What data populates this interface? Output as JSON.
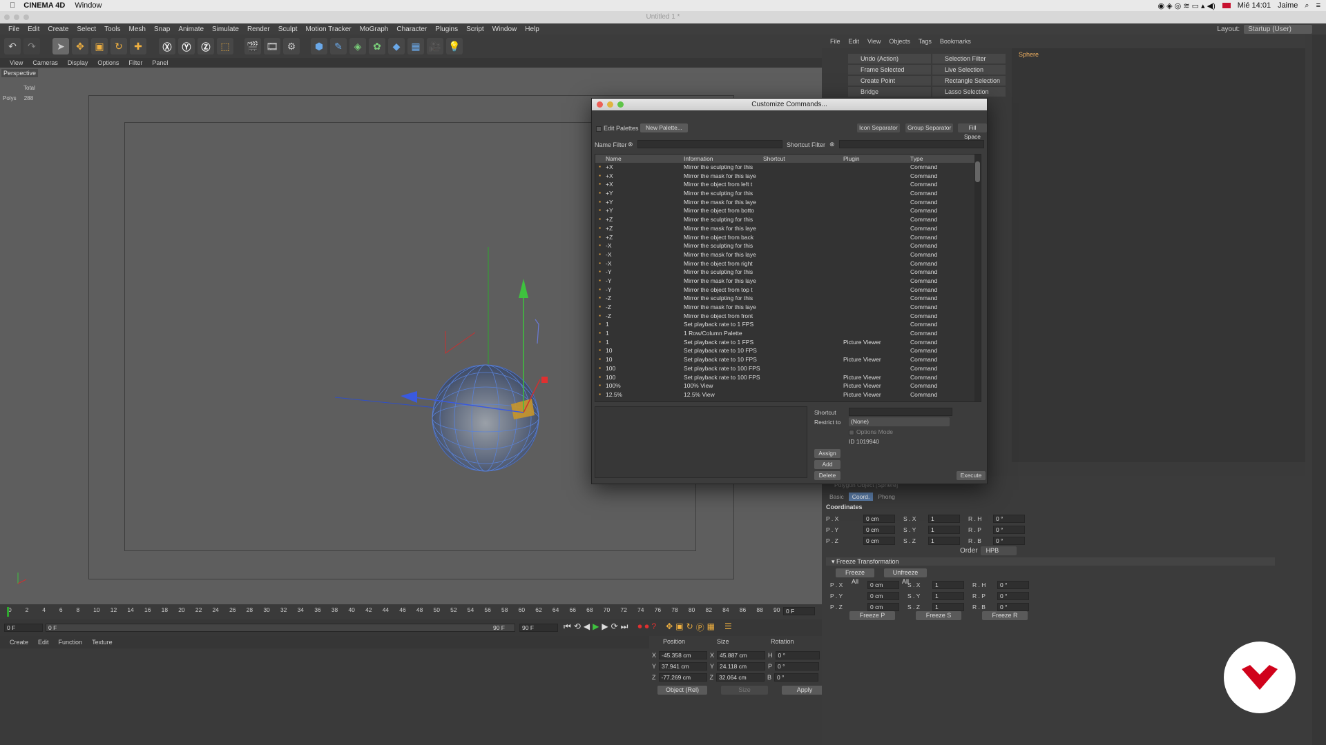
{
  "mac": {
    "app_name": "CINEMA 4D",
    "menu_window": "Window",
    "time": "Mié 14:01",
    "user": "Jaime"
  },
  "window_title": "Untitled 1 *",
  "menus": [
    "File",
    "Edit",
    "Create",
    "Select",
    "Tools",
    "Mesh",
    "Snap",
    "Animate",
    "Simulate",
    "Render",
    "Sculpt",
    "Motion Tracker",
    "MoGraph",
    "Character",
    "Plugins",
    "Script",
    "Window",
    "Help"
  ],
  "layout": {
    "label": "Layout:",
    "value": "Startup (User)"
  },
  "viewport": {
    "menus": [
      "View",
      "Cameras",
      "Display",
      "Options",
      "Filter",
      "Panel"
    ],
    "name": "Perspective",
    "hud_total": "Total",
    "hud_polys_label": "Polys",
    "hud_polys_value": "288"
  },
  "timeline": {
    "ticks": [
      "0",
      "2",
      "4",
      "6",
      "8",
      "10",
      "12",
      "14",
      "16",
      "18",
      "20",
      "22",
      "24",
      "26",
      "28",
      "30",
      "32",
      "34",
      "36",
      "38",
      "40",
      "42",
      "44",
      "46",
      "48",
      "50",
      "52",
      "54",
      "56",
      "58",
      "60",
      "62",
      "64",
      "66",
      "68",
      "70",
      "72",
      "74",
      "76",
      "78",
      "80",
      "82",
      "84",
      "86",
      "88",
      "90"
    ],
    "end_label": "0 F",
    "current": "0 F",
    "range_start": "0 F",
    "range_end": "90 F",
    "max": "90 F"
  },
  "material_manager": {
    "menus": [
      "Create",
      "Edit",
      "Function",
      "Texture"
    ]
  },
  "coord_manager": {
    "headers": [
      "Position",
      "Size",
      "Rotation"
    ],
    "rows": [
      {
        "axis": "X",
        "pos": "-45.358 cm",
        "saxis": "X",
        "size": "45.887 cm",
        "raxis": "H",
        "rot": "0 °"
      },
      {
        "axis": "Y",
        "pos": "37.941 cm",
        "saxis": "Y",
        "size": "24.118 cm",
        "raxis": "P",
        "rot": "0 °"
      },
      {
        "axis": "Z",
        "pos": "-77.269 cm",
        "saxis": "Z",
        "size": "32.064 cm",
        "raxis": "B",
        "rot": "0 °"
      }
    ],
    "mode": "Object (Rel)",
    "size_mode": "Size",
    "apply": "Apply"
  },
  "object_manager": {
    "menus": [
      "File",
      "Edit",
      "View",
      "Objects",
      "Tags",
      "Bookmarks"
    ],
    "object": "Sphere"
  },
  "palette": {
    "left": [
      "Undo (Action)",
      "Frame Selected Elements",
      "Create Point",
      "Bridge"
    ],
    "right": [
      "Selection Filter",
      "Live Selection",
      "Rectangle Selection",
      "Lasso Selection"
    ]
  },
  "attributes": {
    "object_label": "Polygon Object [Sphere]",
    "tabs": [
      "Basic",
      "Coord.",
      "Phong"
    ],
    "section": "Coordinates",
    "coords": [
      {
        "p": "P . X",
        "pv": "0 cm",
        "s": "S . X",
        "sv": "1",
        "r": "R . H",
        "rv": "0 °"
      },
      {
        "p": "P . Y",
        "pv": "0 cm",
        "s": "S . Y",
        "sv": "1",
        "r": "R . P",
        "rv": "0 °"
      },
      {
        "p": "P . Z",
        "pv": "0 cm",
        "s": "S . Z",
        "sv": "1",
        "r": "R . B",
        "rv": "0 °"
      }
    ],
    "order_label": "Order",
    "order_value": "HPB",
    "freeze_section": "Freeze Transformation",
    "freeze_all": "Freeze All",
    "unfreeze_all": "Unfreeze All",
    "freeze_coords": [
      {
        "p": "P . X",
        "pv": "0 cm",
        "s": "S . X",
        "sv": "1",
        "r": "R . H",
        "rv": "0 °"
      },
      {
        "p": "P . Y",
        "pv": "0 cm",
        "s": "S . Y",
        "sv": "1",
        "r": "R . P",
        "rv": "0 °"
      },
      {
        "p": "P . Z",
        "pv": "0 cm",
        "s": "S . Z",
        "sv": "1",
        "r": "R . B",
        "rv": "0 °"
      }
    ],
    "freeze_p": "Freeze P",
    "freeze_s": "Freeze S",
    "freeze_r": "Freeze R"
  },
  "dialog": {
    "title": "Customize Commands...",
    "edit_palettes": "Edit Palettes",
    "new_palette": "New Palette...",
    "icon_separator": "Icon Separator",
    "group_separator": "Group Separator",
    "fill_space": "Fill Space",
    "name_filter": "Name Filter",
    "shortcut_filter": "Shortcut Filter",
    "columns": [
      "Name",
      "Information",
      "Shortcut",
      "Plugin",
      "Type"
    ],
    "rows": [
      {
        "name": "+X",
        "info": "Mirror the sculpting for this",
        "plugin": "",
        "type": "Command"
      },
      {
        "name": "+X",
        "info": "Mirror the mask for this laye",
        "plugin": "",
        "type": "Command"
      },
      {
        "name": "+X",
        "info": "Mirror the object from left t",
        "plugin": "",
        "type": "Command"
      },
      {
        "name": "+Y",
        "info": "Mirror the sculpting for this",
        "plugin": "",
        "type": "Command"
      },
      {
        "name": "+Y",
        "info": "Mirror the mask for this laye",
        "plugin": "",
        "type": "Command"
      },
      {
        "name": "+Y",
        "info": "Mirror the object from botto",
        "plugin": "",
        "type": "Command"
      },
      {
        "name": "+Z",
        "info": "Mirror the sculpting for this",
        "plugin": "",
        "type": "Command"
      },
      {
        "name": "+Z",
        "info": "Mirror the mask for this laye",
        "plugin": "",
        "type": "Command"
      },
      {
        "name": "+Z",
        "info": "Mirror the object from back",
        "plugin": "",
        "type": "Command"
      },
      {
        "name": "-X",
        "info": "Mirror the sculpting for this",
        "plugin": "",
        "type": "Command"
      },
      {
        "name": "-X",
        "info": "Mirror the mask for this laye",
        "plugin": "",
        "type": "Command"
      },
      {
        "name": "-X",
        "info": "Mirror the object from right",
        "plugin": "",
        "type": "Command"
      },
      {
        "name": "-Y",
        "info": "Mirror the sculpting for this",
        "plugin": "",
        "type": "Command"
      },
      {
        "name": "-Y",
        "info": "Mirror the mask for this laye",
        "plugin": "",
        "type": "Command"
      },
      {
        "name": "-Y",
        "info": "Mirror the object from top t",
        "plugin": "",
        "type": "Command"
      },
      {
        "name": "-Z",
        "info": "Mirror the sculpting for this",
        "plugin": "",
        "type": "Command"
      },
      {
        "name": "-Z",
        "info": "Mirror the mask for this laye",
        "plugin": "",
        "type": "Command"
      },
      {
        "name": "-Z",
        "info": "Mirror the object from front",
        "plugin": "",
        "type": "Command"
      },
      {
        "name": "1",
        "info": "Set playback rate to 1 FPS",
        "plugin": "",
        "type": "Command"
      },
      {
        "name": "1",
        "info": "1 Row/Column Palette",
        "plugin": "",
        "type": "Command"
      },
      {
        "name": "1",
        "info": "Set playback rate to 1 FPS",
        "plugin": "Picture Viewer",
        "type": "Command"
      },
      {
        "name": "10",
        "info": "Set playback rate to 10 FPS",
        "plugin": "",
        "type": "Command"
      },
      {
        "name": "10",
        "info": "Set playback rate to 10 FPS",
        "plugin": "Picture Viewer",
        "type": "Command"
      },
      {
        "name": "100",
        "info": "Set playback rate to 100 FPS",
        "plugin": "",
        "type": "Command"
      },
      {
        "name": "100",
        "info": "Set playback rate to 100 FPS",
        "plugin": "Picture Viewer",
        "type": "Command"
      },
      {
        "name": "100%",
        "info": "100% View",
        "plugin": "Picture Viewer",
        "type": "Command"
      },
      {
        "name": "12.5%",
        "info": "12.5% View",
        "plugin": "Picture Viewer",
        "type": "Command"
      }
    ],
    "shortcut_label": "Shortcut",
    "restrict_label": "Restrict to",
    "restrict_value": "(None)",
    "options_mode": "Options Mode",
    "id_text": "ID 1019940",
    "assign": "Assign",
    "add": "Add",
    "delete": "Delete",
    "execute": "Execute"
  },
  "colors": {
    "accent": "#5c7eaa",
    "logo_red": "#d0021b"
  }
}
